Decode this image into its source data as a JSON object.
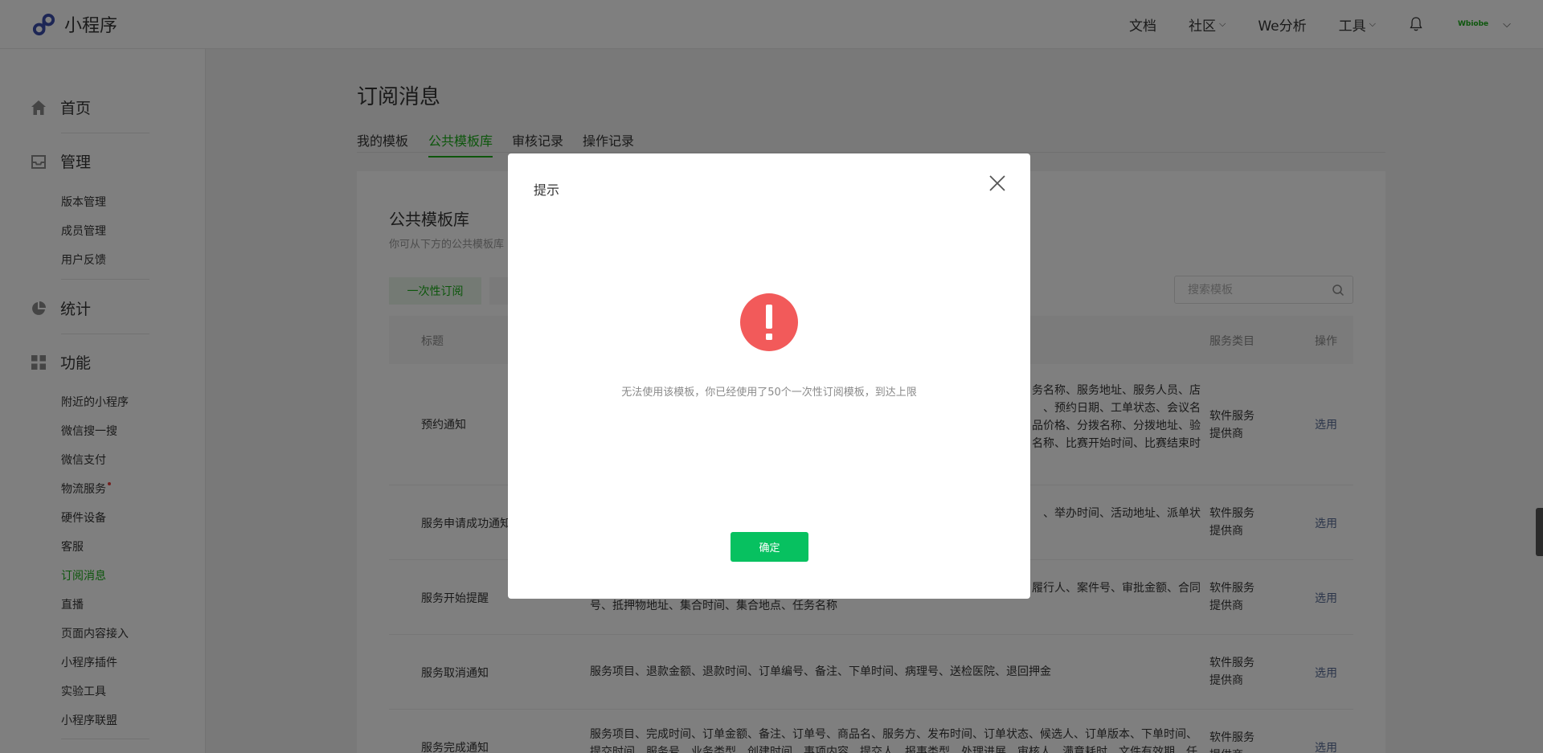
{
  "header": {
    "logo_text": "小程序",
    "nav": [
      {
        "label": "文档",
        "caret": false
      },
      {
        "label": "社区",
        "caret": true
      },
      {
        "label": "We分析",
        "caret": false
      },
      {
        "label": "工具",
        "caret": true
      }
    ],
    "account_logo_text": "Wbiobe",
    "caret_glyph": "⌵"
  },
  "sidebar": {
    "home": "首页",
    "manage": "管理",
    "manage_items": [
      "版本管理",
      "成员管理",
      "用户反馈"
    ],
    "stats": "统计",
    "features": "功能",
    "feature_items": [
      "附近的小程序",
      "微信搜一搜",
      "微信支付",
      "物流服务",
      "硬件设备",
      "客服",
      "订阅消息",
      "直播",
      "页面内容接入",
      "小程序插件",
      "实验工具",
      "小程序联盟"
    ],
    "active_item": "订阅消息"
  },
  "main": {
    "title": "订阅消息",
    "tabs": [
      "我的模板",
      "公共模板库",
      "审核记录",
      "操作记录"
    ],
    "active_tab": "公共模板库"
  },
  "panel": {
    "title": "公共模板库",
    "desc": "你可从下方的公共模板库",
    "type_button": "一次性订阅",
    "search_placeholder": "搜索模板",
    "columns": {
      "title": "标题",
      "category": "服务类目",
      "operation": "操作"
    },
    "rows": [
      {
        "title": "预约通知",
        "fields": [
          "务名称、服务地址、服务人员、店",
          "、预约日期、工单状态、会议名",
          "品价格、分拨名称、分拨地址、验",
          "名称、比赛开始时间、比赛结束时"
        ],
        "category": [
          "软件服务",
          "提供商"
        ],
        "op": "选用"
      },
      {
        "title": "服务申请成功通知",
        "fields": [
          "、举办时间、活动地址、派单状"
        ],
        "category": [
          "软件服务",
          "提供商"
        ],
        "op": "选用"
      },
      {
        "title": "服务开始提醒",
        "fields": [
          "履行人、案件号、审批金额、合同",
          "号、抵押物地址、集合时间、集合地点、任务名称"
        ],
        "category": [
          "软件服务",
          "提供商"
        ],
        "op": "选用"
      },
      {
        "title": "服务取消通知",
        "fields": [
          "服务项目、退款金额、退款时间、订单编号、备注、下单时间、病理号、送检医院、退回押金"
        ],
        "category": [
          "软件服务",
          "提供商"
        ],
        "op": "选用"
      },
      {
        "title": "服务完成通知",
        "fields": [
          "服务项目、完成时间、订单金额、备注、订单号、商品名、服务方、发布时间、订单状态、候选人、订单版本、下单时间、",
          "提交时间、服务号、业务类型、创建时间、事项内容、提交人、报事类型、处理进展、审核人、满意耗时、文件有效期、任"
        ],
        "category": [
          "软件服务",
          "提供商"
        ],
        "op": "选用"
      }
    ]
  },
  "modal": {
    "title": "提示",
    "message": "无法使用该模板，你已经使用了50个一次性订阅模板，到达上限",
    "confirm": "确定",
    "alert_color": "#f25a5a",
    "confirm_color": "#07c160"
  }
}
